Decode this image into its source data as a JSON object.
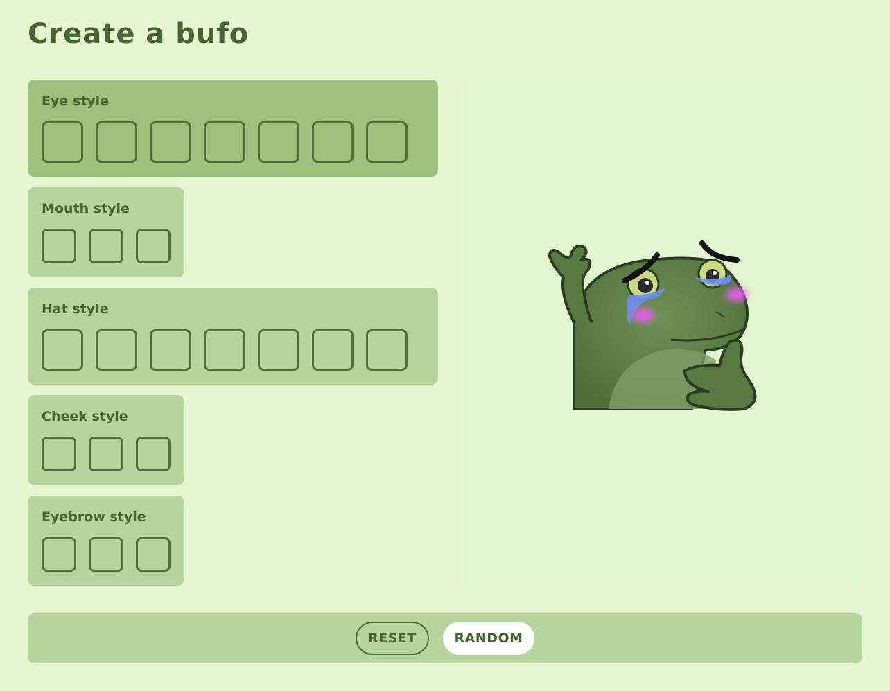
{
  "page": {
    "title": "Create a bufo"
  },
  "panels": {
    "eye": {
      "label": "Eye style",
      "option_count": 7
    },
    "mouth": {
      "label": "Mouth style",
      "option_count": 3
    },
    "hat": {
      "label": "Hat style",
      "option_count": 7
    },
    "cheek": {
      "label": "Cheek style",
      "option_count": 3
    },
    "eyebrow": {
      "label": "Eyebrow style",
      "option_count": 3
    }
  },
  "actions": {
    "reset_label": "RESET",
    "random_label": "RANDOM"
  },
  "colors": {
    "background": "#e6f6d1",
    "panel": "#b6d59c",
    "panel_active": "#9bc17d",
    "text": "#46652f",
    "preview_background": "#e1f7cf"
  }
}
